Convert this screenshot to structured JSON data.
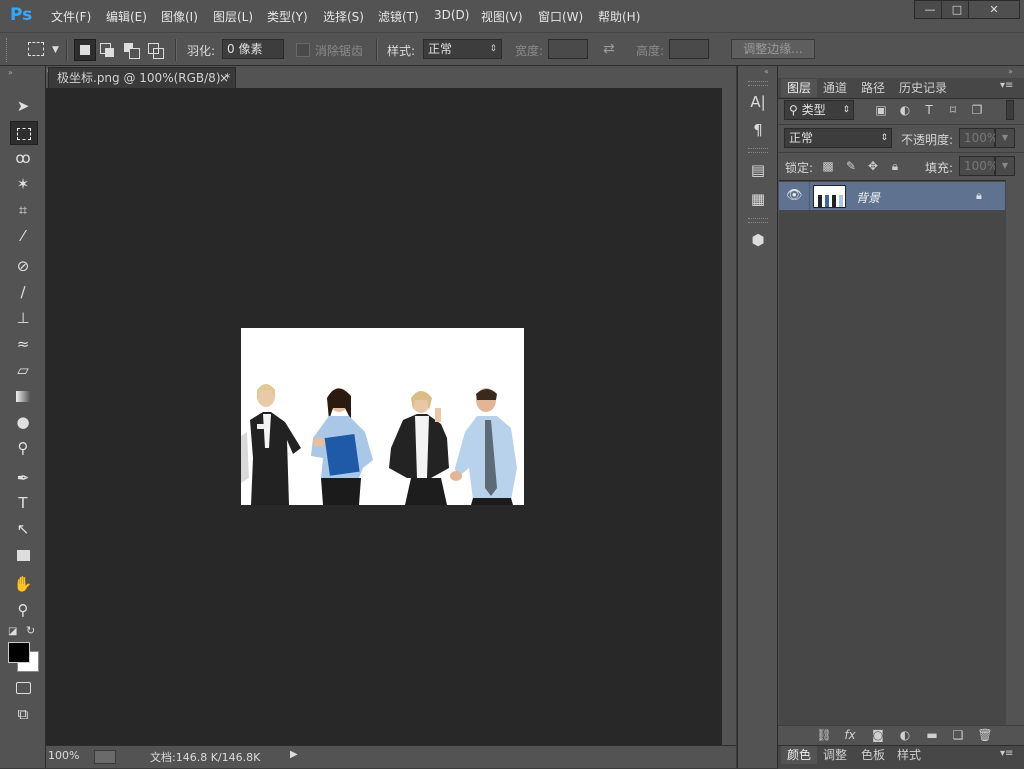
{
  "app": {
    "logo": "Ps"
  },
  "menu": [
    "文件(F)",
    "编辑(E)",
    "图像(I)",
    "图层(L)",
    "类型(Y)",
    "选择(S)",
    "滤镜(T)",
    "3D(D)",
    "视图(V)",
    "窗口(W)",
    "帮助(H)"
  ],
  "window_controls": {
    "minimize": "—",
    "maximize": "□",
    "close": "✕"
  },
  "options": {
    "feather_label": "羽化:",
    "feather_value": "0 像素",
    "antialias_label": "消除锯齿",
    "style_label": "样式:",
    "style_value": "正常",
    "width_label": "宽度:",
    "height_label": "高度:",
    "refine_edge": "调整边缘..."
  },
  "document": {
    "tab_title": "极坐标.png @ 100%(RGB/8) *",
    "tab_close": "×",
    "zoom": "100%",
    "doc_info": "文档:146.8 K/146.8K"
  },
  "layers_panel": {
    "tabs": [
      "图层",
      "通道",
      "路径",
      "历史记录"
    ],
    "filter_value": "类型",
    "blend_mode": "正常",
    "opacity_label": "不透明度:",
    "opacity_value": "100%",
    "lock_label": "锁定:",
    "fill_label": "填充:",
    "fill_value": "100%",
    "layers": [
      {
        "name": "背景",
        "visible": true,
        "locked": true
      }
    ]
  },
  "bottom_tabs": [
    "颜色",
    "调整",
    "色板",
    "样式"
  ],
  "colors": {
    "accent": "#33a8ff",
    "layer_selected": "#5f7391",
    "foreground": "#000000",
    "background": "#ffffff"
  }
}
